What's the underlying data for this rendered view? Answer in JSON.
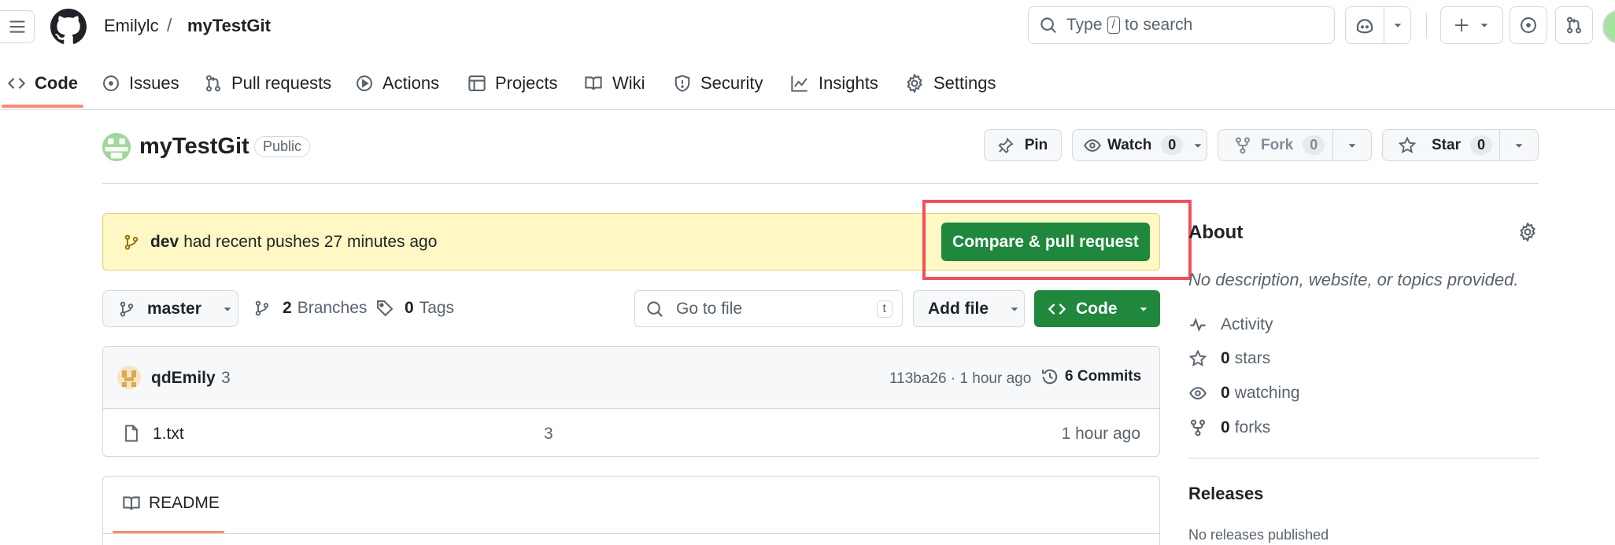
{
  "header": {
    "owner": "Emilylc",
    "separator": "/",
    "repo": "myTestGit",
    "search_pre": "Type",
    "search_key": "/",
    "search_post": "to search"
  },
  "tabs": [
    {
      "label": "Code",
      "icon": "code-icon",
      "active": true
    },
    {
      "label": "Issues",
      "icon": "issue-icon"
    },
    {
      "label": "Pull requests",
      "icon": "pull-request-icon"
    },
    {
      "label": "Actions",
      "icon": "play-icon"
    },
    {
      "label": "Projects",
      "icon": "table-icon"
    },
    {
      "label": "Wiki",
      "icon": "book-icon"
    },
    {
      "label": "Security",
      "icon": "shield-icon"
    },
    {
      "label": "Insights",
      "icon": "graph-icon"
    },
    {
      "label": "Settings",
      "icon": "gear-icon"
    }
  ],
  "repo_header": {
    "name": "myTestGit",
    "visibility": "Public",
    "pin_label": "Pin",
    "watch_label": "Watch",
    "watch_count": "0",
    "fork_label": "Fork",
    "fork_count": "0",
    "star_label": "Star",
    "star_count": "0"
  },
  "banner": {
    "branch": "dev",
    "message": "had recent pushes 27 minutes ago",
    "button_label": "Compare & pull request",
    "highlight_color": "#f0505a"
  },
  "toolbar": {
    "branch": "master",
    "branches_count": "2",
    "branches_label": "Branches",
    "tags_count": "0",
    "tags_label": "Tags",
    "goto_placeholder": "Go to file",
    "goto_key": "t",
    "add_file_label": "Add file",
    "code_label": "Code"
  },
  "commit": {
    "author": "qdEmily",
    "message": "3",
    "hash_time": "113ba26 · 1 hour ago",
    "commits_label": "6 Commits"
  },
  "files": [
    {
      "name": "1.txt",
      "message": "3",
      "time": "1 hour ago"
    }
  ],
  "readme": {
    "label": "README"
  },
  "about": {
    "title": "About",
    "description": "No description, website, or topics provided.",
    "activity": "Activity",
    "stars_count": "0",
    "stars_label": "stars",
    "watching_count": "0",
    "watching_label": "watching",
    "forks_count": "0",
    "forks_label": "forks"
  },
  "releases": {
    "title": "Releases",
    "empty": "No releases published"
  },
  "colors": {
    "green": "#1f883d",
    "tab_underline": "#fd8c73",
    "banner_bg": "#fff8c5"
  }
}
